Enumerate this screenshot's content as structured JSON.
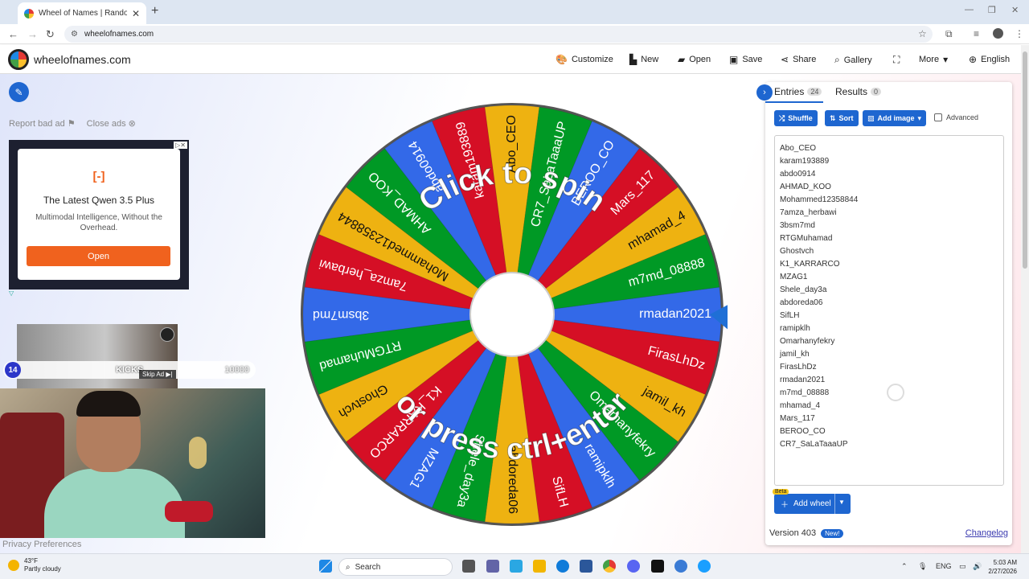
{
  "browser": {
    "tab_title": "Wheel of Names | Random nam",
    "url": "wheelofnames.com"
  },
  "header": {
    "site_name": "wheelofnames.com",
    "nav": [
      {
        "label": "Customize",
        "icon": "palette-icon"
      },
      {
        "label": "New",
        "icon": "file-icon"
      },
      {
        "label": "Open",
        "icon": "folder-icon"
      },
      {
        "label": "Save",
        "icon": "save-icon"
      },
      {
        "label": "Share",
        "icon": "share-icon"
      },
      {
        "label": "Gallery",
        "icon": "search-icon"
      },
      {
        "label": "",
        "icon": "fullscreen-icon"
      },
      {
        "label": "More",
        "icon": "chevron-down-icon"
      },
      {
        "label": "English",
        "icon": "globe-icon"
      }
    ]
  },
  "left": {
    "report_ad": "Report bad ad",
    "close_ads": "Close ads",
    "ad": {
      "headline": "The Latest Qwen 3.5 Plus",
      "subtext": "Multimodal Intelligence, Without the Overhead.",
      "button": "Open"
    },
    "stream": {
      "level": "14",
      "label": "KICKS",
      "value": "10000",
      "skip": "Skip Ad ▶|"
    },
    "privacy": "Privacy Preferences"
  },
  "wheel": {
    "overlay_top": "Click to spin",
    "overlay_bottom": "or press ctrl+enter",
    "segment_colors": [
      "#3369e8",
      "#d50f25",
      "#eeb211",
      "#009925"
    ],
    "segments": [
      "rmadan2021",
      "FirasLhDz",
      "jamil_kh",
      "Omarhanyfekry",
      "ramipklh",
      "SifLH",
      "abdoreda06",
      "Shele_day3a",
      "MZAG1",
      "K1_KARRARCO",
      "Ghostvch",
      "RTGMuhamad",
      "3bsm7md",
      "7amza_herbawi",
      "Mohammed12358844",
      "AHMAD_KOO",
      "abdo0914",
      "karam193889",
      "Abo_CEO",
      "CR7_SaLaTaaaUP",
      "BEROO_CO",
      "Mars_117",
      "mhamad_4",
      "m7md_08888"
    ]
  },
  "panel": {
    "tab_entries": "Entries",
    "entries_count": "24",
    "tab_results": "Results",
    "results_count": "0",
    "shuffle": "Shuffle",
    "sort": "Sort",
    "add_image": "Add image",
    "advanced": "Advanced",
    "entries": [
      "Abo_CEO",
      "karam193889",
      "abdo0914",
      "AHMAD_KOO",
      "Mohammed12358844",
      "7amza_herbawi",
      "3bsm7md",
      "RTGMuhamad",
      "Ghostvch",
      "K1_KARRARCO",
      "MZAG1",
      "Shele_day3a",
      "abdoreda06",
      "SifLH",
      "ramipklh",
      "Omarhanyfekry",
      "jamil_kh",
      "FirasLhDz",
      "rmadan2021",
      "m7md_08888",
      "mhamad_4",
      "Mars_117",
      "BEROO_CO",
      "CR7_SaLaTaaaUP"
    ],
    "add_wheel": "Add wheel",
    "beta": "Beta",
    "version": "Version 403",
    "new_badge": "New!",
    "changelog": "Changelog"
  },
  "taskbar": {
    "temp": "43°F",
    "weather": "Partly cloudy",
    "search": "Search",
    "lang": "ENG",
    "time": "5:03 AM",
    "date": "2/27/2026"
  }
}
